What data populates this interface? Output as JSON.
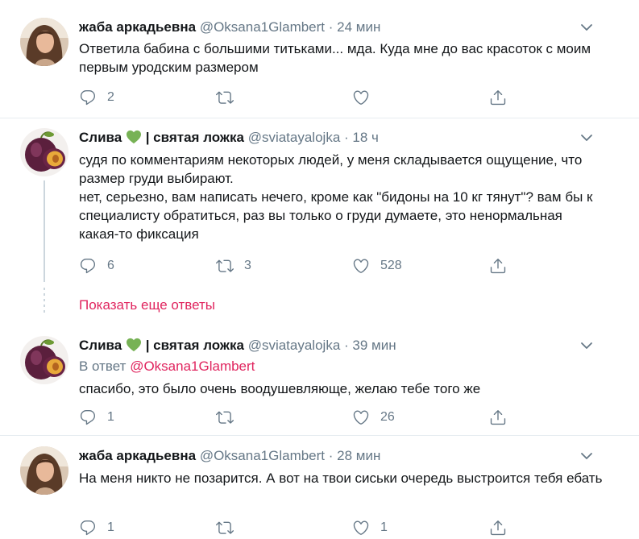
{
  "colors": {
    "accent": "#e0245e",
    "secondary_text": "#657786",
    "divider": "#e6ecf0",
    "icon": "#657786",
    "green_heart": "#77b255"
  },
  "tweets": [
    {
      "author_name": "жаба аркадьевна",
      "author_handle": "@Oksana1Glambert",
      "separator": "·",
      "time": "24 мин",
      "text": "Ответила бабина с большими титьками... мда. Куда мне до вас красоток с моим первым уродским размером",
      "counts": {
        "reply": "2",
        "retweet": "",
        "like": ""
      },
      "avatar": "woman-photo"
    },
    {
      "author_name": "Слива",
      "author_name_suffix": "| святая ложка",
      "author_handle": "@sviatayalojka",
      "separator": "·",
      "time": "18 ч",
      "text": "судя по комментариям некоторых людей, у меня складывается ощущение, что размер груди выбирают.\nнет, серьезно, вам написать нечего, кроме как \"бидоны на 10 кг тянут\"? вам бы к специалисту обратиться, раз вы только о груди думаете, это ненормальная какая-то фиксация",
      "counts": {
        "reply": "6",
        "retweet": "3",
        "like": "528"
      },
      "avatar": "plum-photo"
    },
    {
      "author_name": "Слива",
      "author_name_suffix": "| святая ложка",
      "author_handle": "@sviatayalojka",
      "separator": "·",
      "time": "39 мин",
      "reply_prefix": "В ответ",
      "reply_handle": "@Oksana1Glambert",
      "text": "спасибо, это было очень воодушевляюще, желаю тебе того же",
      "counts": {
        "reply": "1",
        "retweet": "",
        "like": "26"
      },
      "avatar": "plum-photo"
    },
    {
      "author_name": "жаба аркадьевна",
      "author_handle": "@Oksana1Glambert",
      "separator": "·",
      "time": "28 мин",
      "text": "На меня никто не позарится. А вот на твои сиськи очередь выстроится тебя ебать",
      "counts": {
        "reply": "1",
        "retweet": "",
        "like": "1"
      },
      "avatar": "woman-photo"
    }
  ],
  "show_more_label": "Показать еще ответы",
  "icons": [
    "reply-icon",
    "retweet-icon",
    "like-icon",
    "share-icon",
    "chevron-down-icon",
    "green-heart-icon"
  ]
}
